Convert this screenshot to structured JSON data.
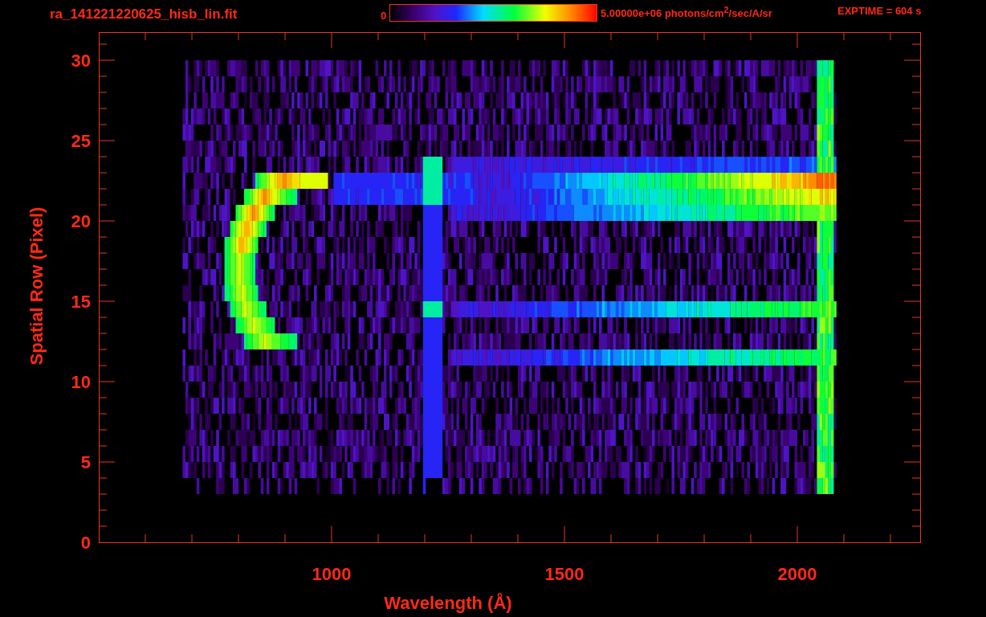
{
  "header": {
    "filename": "ra_141221220625_hisb_lin.fit",
    "colorbar": {
      "min_label": "0",
      "max_label": "5.00000e+06 photons/cm$^{2}$/sec/A/sr"
    },
    "exptime": "EXPTIME = 604 s"
  },
  "plot": {
    "ylabel": "Spatial Row (Pixel)",
    "xlabel": "Wavelength (Å)",
    "yticks": [
      "30",
      "25",
      "20",
      "15",
      "10",
      "5",
      "0"
    ],
    "xticks": [
      "1000",
      "1500",
      "2000"
    ]
  }
}
